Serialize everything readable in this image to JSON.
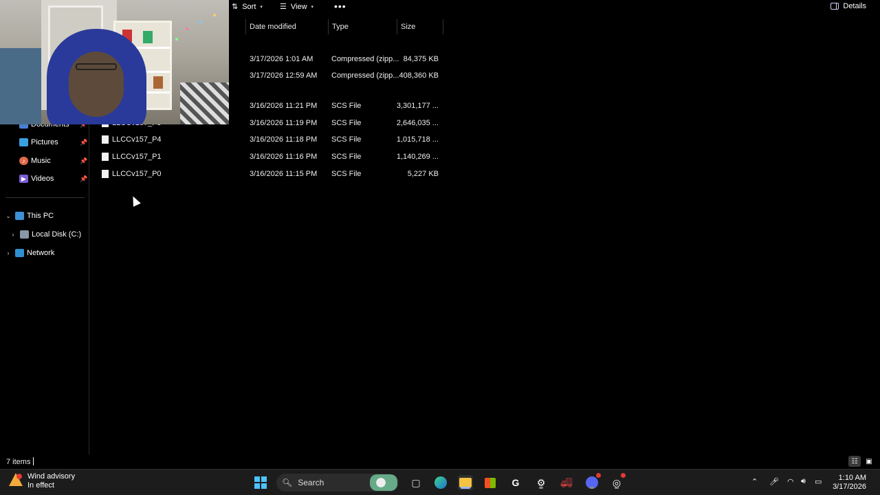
{
  "toolbar": {
    "sort_label": "Sort",
    "view_label": "View",
    "more_label": "•••",
    "details_label": "Details"
  },
  "columns": {
    "date_modified": "Date modified",
    "type": "Type",
    "size": "Size"
  },
  "sidebar": {
    "quick_access": [
      {
        "label": "Documents",
        "icon": "documents-icon",
        "color": "#4a7fd4"
      },
      {
        "label": "Pictures",
        "icon": "pictures-icon",
        "color": "#3aa0e0"
      },
      {
        "label": "Music",
        "icon": "music-icon",
        "color": "#e06a4a"
      },
      {
        "label": "Videos",
        "icon": "videos-icon",
        "color": "#7b5cd6"
      }
    ],
    "this_pc": "This PC",
    "local_disk": "Local Disk (C:)",
    "network": "Network"
  },
  "files": [
    {
      "name": "",
      "date": "3/17/2026 1:01 AM",
      "type": "Compressed (zipp...",
      "size": "84,375 KB"
    },
    {
      "name": "",
      "date": "3/17/2026 12:59 AM",
      "type": "Compressed (zipp...",
      "size": "408,360 KB"
    },
    {
      "name": "",
      "date": "3/16/2026 11:21 PM",
      "type": "SCS File",
      "size": "3,301,177 ..."
    },
    {
      "name": "LLCCv157_P5",
      "date": "3/16/2026 11:19 PM",
      "type": "SCS File",
      "size": "2,646,035 ..."
    },
    {
      "name": "LLCCv157_P4",
      "date": "3/16/2026 11:18 PM",
      "type": "SCS File",
      "size": "1,015,718 ..."
    },
    {
      "name": "LLCCv157_P1",
      "date": "3/16/2026 11:16 PM",
      "type": "SCS File",
      "size": "1,140,269 ..."
    },
    {
      "name": "LLCCv157_P0",
      "date": "3/16/2026 11:15 PM",
      "type": "SCS File",
      "size": "5,227 KB"
    }
  ],
  "status": {
    "item_count": "7 items"
  },
  "taskbar": {
    "weather_title": "Wind advisory",
    "weather_subtitle": "In effect",
    "search_label": "Search",
    "time": "1:10 AM",
    "date": "3/17/2026"
  }
}
